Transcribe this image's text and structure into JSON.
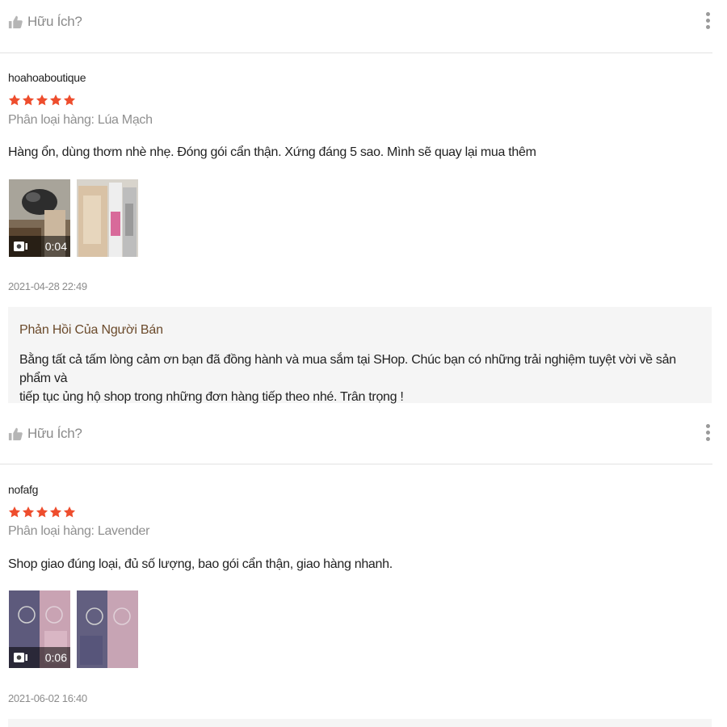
{
  "colors": {
    "star": "#ee4d2d",
    "reply_title": "#6b4a2b",
    "muted": "#8f8f8f"
  },
  "helpful_label": "Hữu Ích?",
  "reviews": [
    {
      "username": "hoahoaboutique",
      "rating": 5,
      "variation": "Phân loại hàng: Lúa Mạch",
      "comment": "Hàng ổn, dùng thơm nhè nhẹ. Đóng gói cẩn thận. Xứng đáng 5 sao. Mình sẽ quay lại mua thêm",
      "video_duration": "0:04",
      "timestamp": "2021-04-28 22:49",
      "seller_reply": {
        "title": "Phản Hồi Của Người Bán",
        "line1": "Bằng tất cả tấm lòng cảm ơn bạn đã đồng hành và mua sắm tại SHop. Chúc bạn có những trải nghiệm tuyệt vời về sản phẩm và",
        "line2": "tiếp tục ủng hộ shop trong những đơn hàng tiếp theo nhé. Trân trọng !"
      }
    },
    {
      "username": "nofafg",
      "rating": 5,
      "variation": "Phân loại hàng: Lavender",
      "comment": "Shop giao đúng loại, đủ số lượng, bao gói cẩn thận, giao hàng nhanh.",
      "video_duration": "0:06",
      "timestamp": "2021-06-02 16:40"
    }
  ]
}
